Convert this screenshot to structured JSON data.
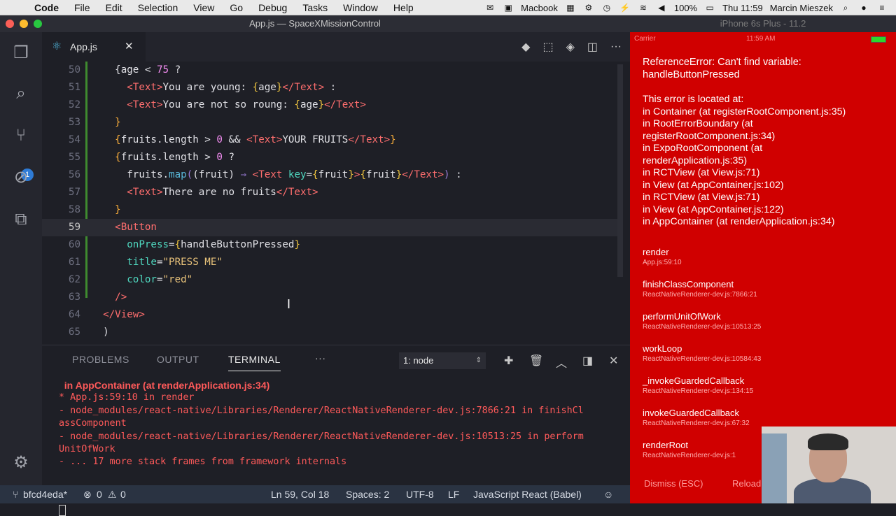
{
  "menubar": {
    "app": "Code",
    "items": [
      "File",
      "Edit",
      "Selection",
      "View",
      "Go",
      "Debug",
      "Tasks",
      "Window",
      "Help"
    ],
    "macbook": "Macbook",
    "battery": "100%",
    "clock": "Thu 11:59",
    "user": "Marcin Mieszek"
  },
  "window": {
    "title": "App.js — SpaceXMissionControl"
  },
  "activity": {
    "badge": "1"
  },
  "tab": {
    "label": "App.js",
    "close": "✕"
  },
  "editor": {
    "lines": [
      {
        "n": "50",
        "segs": [
          [
            "p",
            "    {"
          ],
          [
            "p",
            "age < "
          ],
          [
            "n",
            "75"
          ],
          [
            "p",
            " ?"
          ]
        ]
      },
      {
        "n": "51",
        "segs": [
          [
            "p",
            "      "
          ],
          [
            "t",
            "<Text>"
          ],
          [
            "p",
            "You are young: "
          ],
          [
            "o",
            "{"
          ],
          [
            "p",
            "age"
          ],
          [
            "o",
            "}"
          ],
          [
            "t",
            "</Text>"
          ],
          [
            "p",
            " :"
          ]
        ]
      },
      {
        "n": "52",
        "segs": [
          [
            "p",
            "      "
          ],
          [
            "t",
            "<Text>"
          ],
          [
            "p",
            "You are not so roung: "
          ],
          [
            "o",
            "{"
          ],
          [
            "p",
            "age"
          ],
          [
            "o",
            "}"
          ],
          [
            "t",
            "</Text>"
          ]
        ]
      },
      {
        "n": "53",
        "segs": [
          [
            "br",
            "    }"
          ]
        ]
      },
      {
        "n": "54",
        "segs": [
          [
            "br",
            "    {"
          ],
          [
            "p",
            "fruits.length > "
          ],
          [
            "n",
            "0"
          ],
          [
            "p",
            " && "
          ],
          [
            "t",
            "<Text>"
          ],
          [
            "p",
            "YOUR FRUITS"
          ],
          [
            "t",
            "</Text>"
          ],
          [
            "br",
            "}"
          ]
        ]
      },
      {
        "n": "55",
        "segs": [
          [
            "br",
            "    {"
          ],
          [
            "p",
            "fruits.length > "
          ],
          [
            "n",
            "0"
          ],
          [
            "p",
            " ?"
          ]
        ]
      },
      {
        "n": "56",
        "segs": [
          [
            "p",
            "      fruits."
          ],
          [
            "fn",
            "map"
          ],
          [
            "ar",
            "("
          ],
          [
            "p",
            "(fruit) "
          ],
          [
            "ar",
            "⇒"
          ],
          [
            "p",
            " "
          ],
          [
            "t",
            "<Text "
          ],
          [
            "f",
            "key"
          ],
          [
            "p",
            "="
          ],
          [
            "o",
            "{"
          ],
          [
            "p",
            "fruit"
          ],
          [
            "o",
            "}"
          ],
          [
            "t",
            ">"
          ],
          [
            "o",
            "{"
          ],
          [
            "p",
            "fruit"
          ],
          [
            "o",
            "}"
          ],
          [
            "t",
            "</Text>"
          ],
          [
            "ar",
            ")"
          ],
          [
            "p",
            " :"
          ]
        ]
      },
      {
        "n": "57",
        "segs": [
          [
            "p",
            "      "
          ],
          [
            "t",
            "<Text>"
          ],
          [
            "p",
            "There are no fruits"
          ],
          [
            "t",
            "</Text>"
          ]
        ]
      },
      {
        "n": "58",
        "segs": [
          [
            "br",
            "    }"
          ]
        ]
      },
      {
        "n": "59",
        "segs": [
          [
            "t",
            "    <Button"
          ]
        ]
      },
      {
        "n": "60",
        "segs": [
          [
            "p",
            "      "
          ],
          [
            "f",
            "onPress"
          ],
          [
            "p",
            "="
          ],
          [
            "o",
            "{"
          ],
          [
            "p",
            "handleButtonPressed"
          ],
          [
            "o",
            "}"
          ]
        ]
      },
      {
        "n": "61",
        "segs": [
          [
            "p",
            "      "
          ],
          [
            "f",
            "title"
          ],
          [
            "p",
            "="
          ],
          [
            "s",
            "\"PRESS ME\""
          ]
        ]
      },
      {
        "n": "62",
        "segs": [
          [
            "p",
            "      "
          ],
          [
            "f",
            "color"
          ],
          [
            "p",
            "="
          ],
          [
            "s",
            "\"red\""
          ]
        ]
      },
      {
        "n": "63",
        "segs": [
          [
            "t",
            "    />"
          ]
        ]
      },
      {
        "n": "64",
        "segs": [
          [
            "t",
            "  </View>"
          ]
        ]
      },
      {
        "n": "65",
        "segs": [
          [
            "p",
            "  )"
          ]
        ]
      }
    ]
  },
  "panel": {
    "tabs": [
      "PROBLEMS",
      "OUTPUT",
      "TERMINAL"
    ],
    "more": "···",
    "select": "1: node",
    "terminal": [
      {
        "bold": true,
        "text": "  in AppContainer (at renderApplication.js:34)"
      },
      {
        "bold": false,
        "text": "* App.js:59:10 in render"
      },
      {
        "bold": false,
        "text": "- node_modules/react-native/Libraries/Renderer/ReactNativeRenderer-dev.js:7866:21 in finishCl"
      },
      {
        "bold": false,
        "text": "assComponent"
      },
      {
        "bold": false,
        "text": "- node_modules/react-native/Libraries/Renderer/ReactNativeRenderer-dev.js:10513:25 in perform"
      },
      {
        "bold": false,
        "text": "UnitOfWork"
      },
      {
        "bold": false,
        "text": "- ... 17 more stack frames from framework internals"
      }
    ]
  },
  "status": {
    "branch": "bfcd4eda*",
    "errors": "0",
    "warnings": "0",
    "position": "Ln 59, Col 18",
    "spaces": "Spaces: 2",
    "encoding": "UTF-8",
    "eol": "LF",
    "language": "JavaScript React (Babel)"
  },
  "phone": {
    "title": "iPhone 6s Plus - 11.2",
    "carrier": "Carrier",
    "time": "11:59 AM",
    "error_title": "ReferenceError: Can't find variable: handleButtonPressed",
    "error_body": [
      "This error is located at:",
      "   in Container (at registerRootComponent.js:35)",
      "   in RootErrorBoundary (at",
      "registerRootComponent.js:34)",
      "   in ExpoRootComponent (at",
      "renderApplication.js:35)",
      "   in RCTView (at View.js:71)",
      "   in View (at AppContainer.js:102)",
      "   in RCTView (at View.js:71)",
      "   in View (at AppContainer.js:122)",
      "   in AppContainer (at renderApplication.js:34)"
    ],
    "frames": [
      {
        "name": "render",
        "loc": "App.js:59:10"
      },
      {
        "name": "finishClassComponent",
        "loc": "ReactNativeRenderer-dev.js:7866:21"
      },
      {
        "name": "performUnitOfWork",
        "loc": "ReactNativeRenderer-dev.js:10513:25"
      },
      {
        "name": "workLoop",
        "loc": "ReactNativeRenderer-dev.js:10584:43"
      },
      {
        "name": "_invokeGuardedCallback",
        "loc": "ReactNativeRenderer-dev.js:134:15"
      },
      {
        "name": "invokeGuardedCallback",
        "loc": "ReactNativeRenderer-dev.js:67:32"
      },
      {
        "name": "renderRoot",
        "loc": "ReactNativeRenderer-dev.js:1"
      }
    ],
    "dismiss": "Dismiss (ESC)",
    "reload": "Reload"
  },
  "colors": {
    "accent": "#2e7bd6",
    "error_bg": "#d00000",
    "statusbar": "#2a3342"
  }
}
